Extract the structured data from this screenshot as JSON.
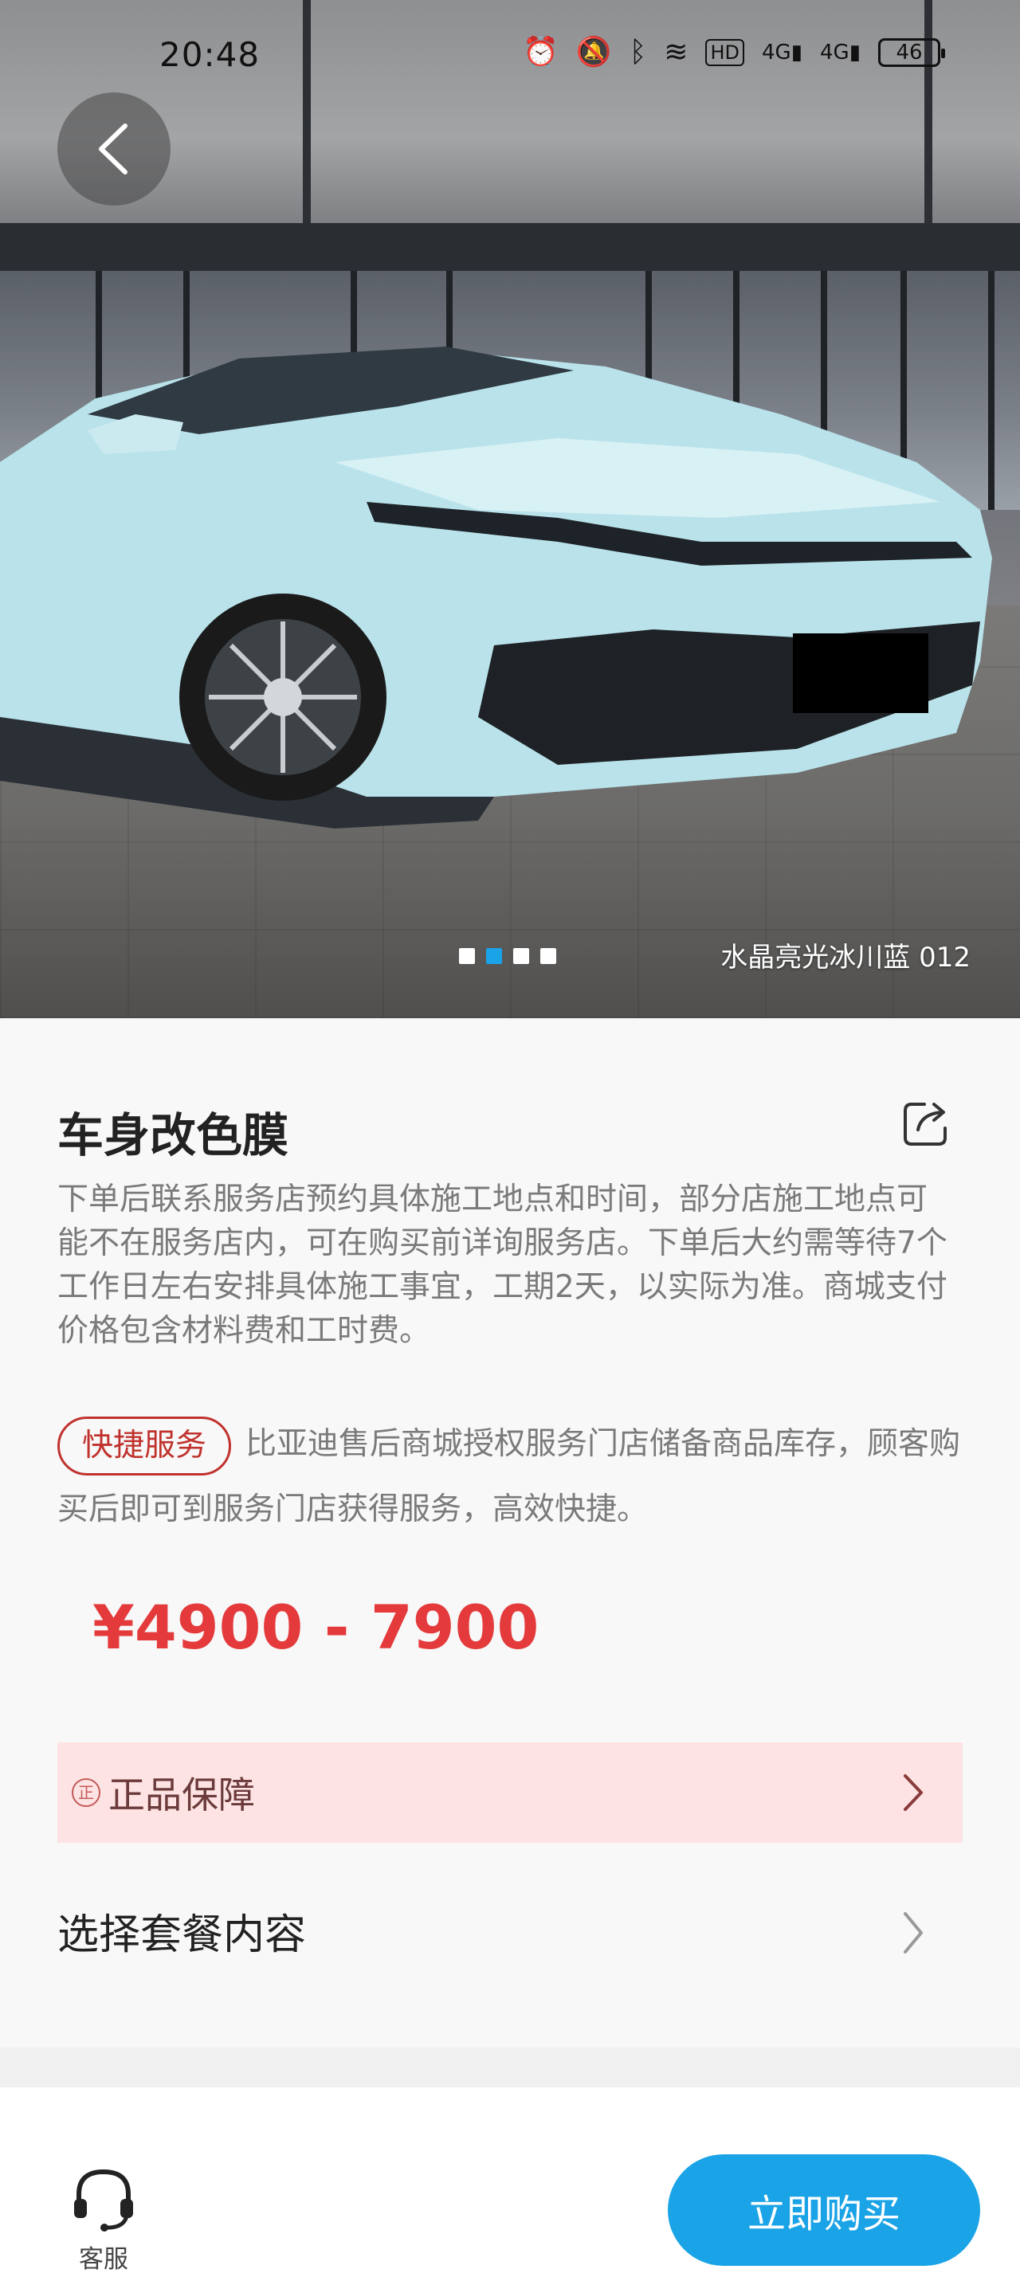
{
  "status_bar": {
    "time": "20:48",
    "battery": "46",
    "icons": [
      "alarm-icon",
      "mute-icon",
      "bluetooth-icon",
      "wifi-icon",
      "hd-icon",
      "signal-4g-icon",
      "signal-4g-icon",
      "battery-icon"
    ]
  },
  "hero": {
    "color_caption": "水晶亮光冰川蓝 012",
    "slide_count": 4,
    "active_slide": 2
  },
  "product": {
    "title": "车身改色膜",
    "description": "下单后联系服务店预约具体施工地点和时间，部分店施工地点可能不在服务店内，可在购买前详询服务店。下单后大约需等待7个工作日左右安排具体施工事宜，工期2天，以实际为准。商城支付价格包含材料费和工时费。",
    "quick_service_badge": "快捷服务",
    "quick_service_text": "比亚迪售后商城授权服务门店储备商品库存，顾客购买后即可到服务门店获得服务，高效快捷。",
    "price": "¥4900 - 7900"
  },
  "guarantee": {
    "icon_char": "正",
    "label": "正品保障"
  },
  "package": {
    "label": "选择套餐内容"
  },
  "bottom_bar": {
    "customer_service_label": "客服",
    "buy_label": "立即购买"
  },
  "colors": {
    "accent_blue": "#1aa3e6",
    "price_red": "#e43a3c",
    "badge_red": "#c0322d",
    "guarantee_bg": "#fde3e3"
  }
}
